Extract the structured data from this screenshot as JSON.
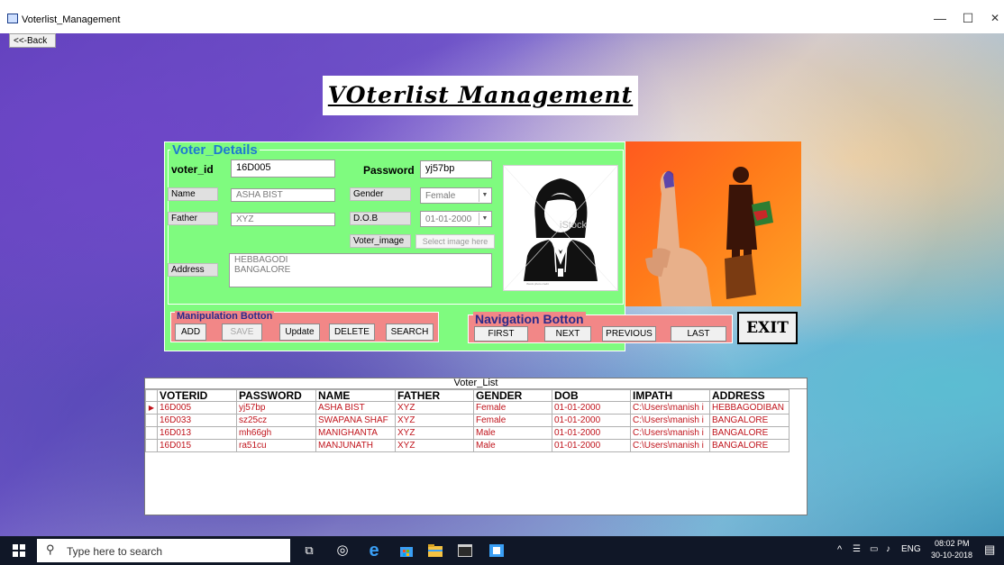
{
  "window": {
    "title": "Voterlist_Management",
    "controls": {
      "minimize": "—",
      "maximize": "☐",
      "close": "✕"
    },
    "back_label": "<<-Back"
  },
  "heading": "VOterlist Management",
  "voter_details": {
    "group_title": "Voter_Details",
    "labels": {
      "voter_id": "voter_id",
      "password": "Password",
      "name": "Name",
      "gender": "Gender",
      "father": "Father",
      "dob": "D.O.B",
      "voter_image": "Voter_image",
      "address": "Address"
    },
    "values": {
      "voter_id": "16D005",
      "password": "yj57bp",
      "name": "ASHA BIST",
      "gender": "Female",
      "father": "XYZ",
      "dob": "01-01-2000",
      "address": "HEBBAGODI\nBANGALORE"
    },
    "select_image_label": "Select image here",
    "photo_watermark": "iStock",
    "photo_credit": "iStock photo credit"
  },
  "manipulation": {
    "title": "Manipulation Botton",
    "buttons": {
      "add": "ADD",
      "save": "SAVE",
      "update": "Update",
      "delete": "DELETE",
      "search": "SEARCH"
    }
  },
  "navigation": {
    "title": "Navigation Botton",
    "buttons": {
      "first": "FIRST",
      "next": "NEXT",
      "previous": "PREVIOUS",
      "last": "LAST"
    }
  },
  "exit_label": "EXIT",
  "voter_list": {
    "caption": "Voter_List",
    "columns": [
      "VOTERID",
      "PASSWORD",
      "NAME",
      "FATHER",
      "GENDER",
      "DOB",
      "IMPATH",
      "ADDRESS"
    ],
    "rows": [
      [
        "16D005",
        "yj57bp",
        "ASHA BIST",
        "XYZ",
        "Female",
        "01-01-2000",
        "C:\\Users\\manish i",
        "HEBBAGODIBAN"
      ],
      [
        "16D033",
        "sz25cz",
        "SWAPANA SHAF",
        "XYZ",
        "Female",
        "01-01-2000",
        "C:\\Users\\manish i",
        "BANGALORE"
      ],
      [
        "16D013",
        "mh66gh",
        "MANIGHANTA",
        "XYZ",
        "Male",
        "01-01-2000",
        "C:\\Users\\manish i",
        "BANGALORE"
      ],
      [
        "16D015",
        "ra51cu",
        "MANJUNATH",
        "XYZ",
        "Male",
        "01-01-2000",
        "C:\\Users\\manish i",
        "BANGALORE"
      ]
    ],
    "selected_row": 0
  },
  "taskbar": {
    "search_placeholder": "Type here to search",
    "language": "ENG",
    "time": "08:02 PM",
    "date": "30-10-2018"
  },
  "colors": {
    "panel_green": "#7ffb7f",
    "group_red": "#f28787",
    "caption_blue": "#1e7ad0",
    "grid_text_red": "#c0141c"
  }
}
